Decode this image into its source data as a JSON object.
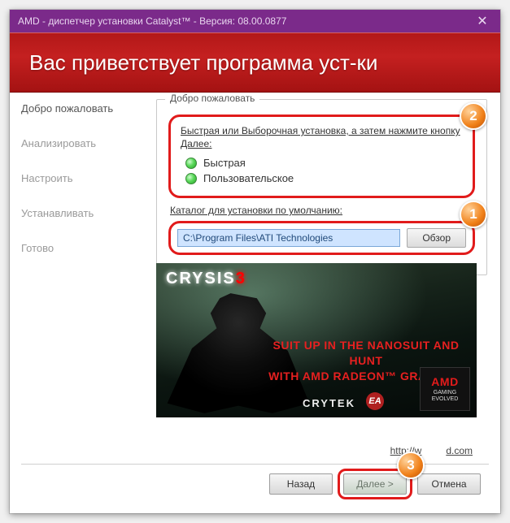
{
  "window": {
    "title": "AMD - диспетчер установки Catalyst™ - Версия: 08.00.0877",
    "close_glyph": "✕"
  },
  "header": {
    "title": "Вас приветствует программа уст-ки"
  },
  "sidebar": {
    "steps": [
      "Добро пожаловать",
      "Анализировать",
      "Настроить",
      "Устанавливать",
      "Готово"
    ]
  },
  "group": {
    "legend": "Добро пожаловать",
    "instruction": "Быстрая или Выборочная установка, а затем нажмите кнопку Далее:",
    "options": {
      "express": "Быстрая",
      "custom": "Пользовательское"
    },
    "catalog_label": "Каталог для установки по умолчанию:",
    "path_value": "C:\\Program Files\\ATI Technologies",
    "browse_label": "Обзор"
  },
  "annotations": {
    "badge1": "1",
    "badge2": "2",
    "badge3": "3"
  },
  "promo": {
    "title_1": "CRYSIS",
    "title_2": "3",
    "tagline_line1": "SUIT UP IN THE NANOSUIT AND HUNT",
    "tagline_line2": "WITH AMD RADEON™ GRAPHICS",
    "crytek": "CRYTEK",
    "ea": "EA",
    "amd": "AMD",
    "gaming_evolved": "GAMING EVOLVED"
  },
  "link": {
    "text": "http://w",
    "text_tail": "d.com"
  },
  "footer": {
    "back": "Назад",
    "next": "Далее >",
    "cancel": "Отмена"
  }
}
